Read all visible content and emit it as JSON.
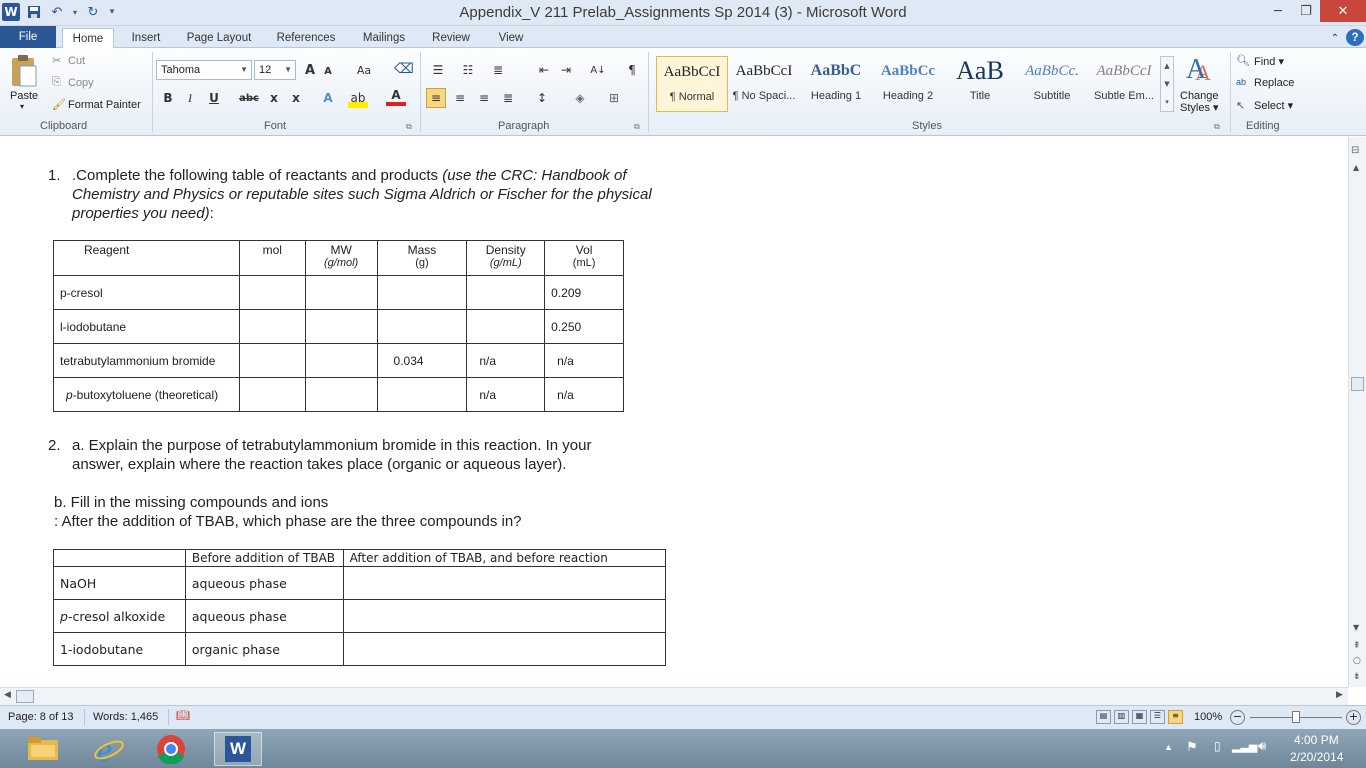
{
  "window": {
    "title": "Appendix_V 211 Prelab_Assignments Sp 2014 (3)  -  Microsoft Word",
    "app_logo": "W",
    "controls": [
      "minimize-icon",
      "restore-icon",
      "close-icon"
    ]
  },
  "tabs": [
    {
      "label": "File"
    },
    {
      "label": "Home"
    },
    {
      "label": "Insert"
    },
    {
      "label": "Page Layout"
    },
    {
      "label": "References"
    },
    {
      "label": "Mailings"
    },
    {
      "label": "Review"
    },
    {
      "label": "View"
    }
  ],
  "ribbon": {
    "clipboard": {
      "paste": "Paste",
      "cut": "Cut",
      "copy": "Copy",
      "format_painter": "Format Painter",
      "label": "Clipboard"
    },
    "font": {
      "name": "Tahoma",
      "size": "12",
      "grow": "A",
      "shrink": "A",
      "change_case": "Aa",
      "bold": "B",
      "italic": "I",
      "underline": "U",
      "strike": "abc",
      "subscript": "x",
      "superscript": "x",
      "label": "Font"
    },
    "paragraph": {
      "label": "Paragraph",
      "pilcrow": "¶",
      "sort": "A↓"
    },
    "styles": {
      "label": "Styles",
      "items": [
        {
          "preview": "AaBbCcI",
          "name": "¶ Normal"
        },
        {
          "preview": "AaBbCcI",
          "name": "¶ No Spaci..."
        },
        {
          "preview": "AaBbC",
          "name": "Heading 1"
        },
        {
          "preview": "AaBbCc",
          "name": "Heading 2"
        },
        {
          "preview": "AaB",
          "name": "Title"
        },
        {
          "preview": "AaBbCc.",
          "name": "Subtitle"
        },
        {
          "preview": "AaBbCcI",
          "name": "Subtle Em..."
        }
      ],
      "change_styles": "Change Styles",
      "change_styles_line1": "Change",
      "change_styles_line2": "Styles"
    },
    "editing": {
      "label": "Editing",
      "find": "Find",
      "replace": "Replace",
      "select": "Select"
    }
  },
  "document": {
    "q1_num": "1.",
    "q1_text": ".Complete the following table of reactants and products ",
    "q1_italic_1": "(use the CRC: Handbook of",
    "q1_italic_2": "Chemistry and Physics or reputable sites such Sigma Aldrich or Fischer for the physical",
    "q1_italic_3": "properties you need)",
    "q1_colon": ":",
    "table1": {
      "headers": [
        {
          "main": "Reagent",
          "sub": ""
        },
        {
          "main": "mol",
          "sub": ""
        },
        {
          "main": "MW",
          "sub": "(g/mol)"
        },
        {
          "main": "Mass",
          "sub": "(g)"
        },
        {
          "main": "Density",
          "sub": "(g/mL)"
        },
        {
          "main": "Vol",
          "sub": "(mL)"
        }
      ],
      "rows": [
        [
          "p-cresol",
          "",
          "",
          "",
          "",
          "0.209"
        ],
        [
          "l-iodobutane",
          "",
          "",
          "",
          "",
          "0.250"
        ],
        [
          "tetrabutylammonium bromide",
          "",
          "",
          "0.034",
          "n/a",
          "n/a"
        ],
        [
          "p-butoxytoluene (theoretical)",
          "",
          "",
          "",
          "n/a",
          "n/a"
        ]
      ],
      "row4_italic_prefix": "p",
      "row4_rest": "-butoxytoluene (theoretical)"
    },
    "q2_num": "2.",
    "q2a_line1": "a. Explain the purpose of tetrabutylammonium bromide in this reaction.  In your",
    "q2a_line2": "answer, explain where the reaction takes place (organic or aqueous layer).",
    "q2b_line1": "b. Fill in the missing compounds and ions",
    "q2b_line2": ": After the addition of TBAB, which phase are the three compounds in?",
    "table2": {
      "headers": [
        "",
        "Before addition of TBAB",
        "After addition of TBAB, and before reaction"
      ],
      "rows": [
        {
          "italic": "",
          "name": "NaOH",
          "before": "aqueous phase",
          "after": ""
        },
        {
          "italic": "p",
          "name": "-cresol alkoxide",
          "before": "aqueous phase",
          "after": ""
        },
        {
          "italic": "",
          "name": "1-iodobutane",
          "before": "organic phase",
          "after": ""
        }
      ]
    }
  },
  "status": {
    "page": "Page: 8 of 13",
    "words": "Words: 1,465",
    "zoom": "100%"
  },
  "taskbar": {
    "time": "4:00 PM",
    "date": "2/20/2014",
    "apps": [
      "file-explorer-icon",
      "internet-explorer-icon",
      "chrome-icon",
      "word-icon"
    ]
  }
}
